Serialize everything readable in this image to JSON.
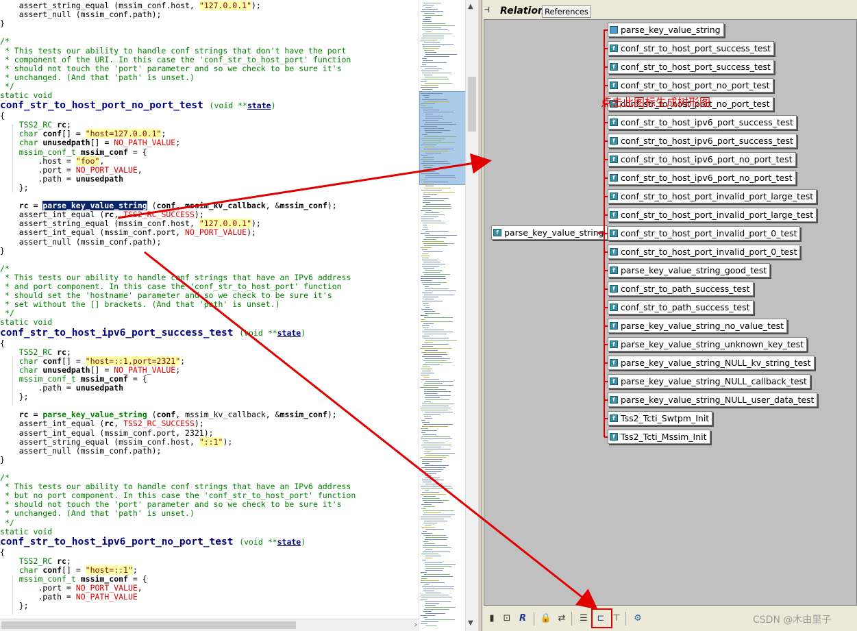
{
  "editor": {
    "lines": [
      "    assert_string_equal (mssim_conf.host, \"127.0.0.1\");",
      "    assert_null (mssim_conf.path);",
      "}",
      "",
      "/*",
      " * This tests our ability to handle conf strings that don't have the port",
      " * component of the URI. In this case the 'conf_str_to_host_port' function",
      " * should not touch the 'port' parameter and so we check to be sure it's",
      " * unchanged. (And that 'path' is unset.)",
      " */",
      "static void",
      "conf_str_to_host_port_no_port_test (void **state)",
      "{",
      "    TSS2_RC rc;",
      "    char conf[] = \"host=127.0.0.1\";",
      "    char unusedpath[] = NO_PATH_VALUE;",
      "    mssim_conf_t mssim_conf = {",
      "        .host = \"foo\",",
      "        .port = NO_PORT_VALUE,",
      "        .path = unusedpath",
      "    };",
      "",
      "    rc = parse_key_value_string (conf, mssim_kv_callback, &mssim_conf);",
      "    assert_int_equal (rc, TSS2_RC_SUCCESS);",
      "    assert_string_equal (mssim_conf.host, \"127.0.0.1\");",
      "    assert_int_equal (mssim_conf.port, NO_PORT_VALUE);",
      "    assert_null (mssim_conf.path);",
      "}",
      "",
      "/*",
      " * This tests our ability to handle conf strings that have an IPv6 address",
      " * and port component. In this case the 'conf_str_to_host_port' function",
      " * should set the 'hostname' parameter and so we check to be sure it's",
      " * set without the [] brackets. (And that 'path' is unset.)",
      " */",
      "static void",
      "conf_str_to_host_ipv6_port_success_test (void **state)",
      "{",
      "    TSS2_RC rc;",
      "    char conf[] = \"host=::1,port=2321\";",
      "    char unusedpath[] = NO_PATH_VALUE;",
      "    mssim_conf_t mssim_conf = {",
      "        .path = unusedpath",
      "    };",
      "",
      "    rc = parse_key_value_string (conf, mssim_kv_callback, &mssim_conf);",
      "    assert_int_equal (rc, TSS2_RC_SUCCESS);",
      "    assert_int_equal (mssim_conf.port, 2321);",
      "    assert_string_equal (mssim_conf.host, \"::1\");",
      "    assert_null (mssim_conf.path);",
      "}",
      "",
      "/*",
      " * This tests our ability to handle conf strings that have an IPv6 address",
      " * but no port component. In this case the 'conf_str_to_host_port' function",
      " * should not touch the 'port' parameter and so we check to be sure it's",
      " * unchanged. (And that 'path' is unset.)",
      " */",
      "static void",
      "conf_str_to_host_ipv6_port_no_port_test (void **state)",
      "{",
      "    TSS2_RC rc;",
      "    char conf[] = \"host=::1\";",
      "    mssim_conf_t mssim_conf = {",
      "        .port = NO_PORT_VALUE,",
      "        .path = NO_PATH_VALUE",
      "    };"
    ]
  },
  "relation": {
    "title": "Relation",
    "tab_label": "References",
    "root": "parse_key_value_string",
    "children": [
      {
        "label": "parse_key_value_string",
        "icon": "file"
      },
      {
        "label": "conf_str_to_host_port_success_test",
        "icon": "func"
      },
      {
        "label": "conf_str_to_host_port_success_test",
        "icon": "func"
      },
      {
        "label": "conf_str_to_host_port_no_port_test",
        "icon": "func"
      },
      {
        "label": "conf_str_to_host_port_no_port_test",
        "icon": "func"
      },
      {
        "label": "conf_str_to_host_ipv6_port_success_test",
        "icon": "func"
      },
      {
        "label": "conf_str_to_host_ipv6_port_success_test",
        "icon": "func"
      },
      {
        "label": "conf_str_to_host_ipv6_port_no_port_test",
        "icon": "func"
      },
      {
        "label": "conf_str_to_host_ipv6_port_no_port_test",
        "icon": "func"
      },
      {
        "label": "conf_str_to_host_port_invalid_port_large_test",
        "icon": "func"
      },
      {
        "label": "conf_str_to_host_port_invalid_port_large_test",
        "icon": "func"
      },
      {
        "label": "conf_str_to_host_port_invalid_port_0_test",
        "icon": "func"
      },
      {
        "label": "conf_str_to_host_port_invalid_port_0_test",
        "icon": "func"
      },
      {
        "label": "parse_key_value_string_good_test",
        "icon": "func"
      },
      {
        "label": "conf_str_to_path_success_test",
        "icon": "func"
      },
      {
        "label": "conf_str_to_path_success_test",
        "icon": "func"
      },
      {
        "label": "parse_key_value_string_no_value_test",
        "icon": "func"
      },
      {
        "label": "parse_key_value_string_unknown_key_test",
        "icon": "func"
      },
      {
        "label": "parse_key_value_string_NULL_kv_string_test",
        "icon": "func"
      },
      {
        "label": "parse_key_value_string_NULL_callback_test",
        "icon": "func"
      },
      {
        "label": "parse_key_value_string_NULL_user_data_test",
        "icon": "func"
      },
      {
        "label": "Tss2_Tcti_Swtpm_Init",
        "icon": "func"
      },
      {
        "label": "Tss2_Tcti_Mssim_Init",
        "icon": "func"
      }
    ],
    "annotation": "点击此图标生成树形图",
    "watermark": "CSDN @木由里子"
  },
  "toolbar": {
    "buttons": [
      "bookmark-icon",
      "new-tab-icon",
      "r-icon",
      "lock-icon",
      "sync-icon",
      "list-icon",
      "tree-icon",
      "hierarchy-icon",
      "gear-icon"
    ]
  },
  "colors": {
    "annotation": "#e00000",
    "selection": "#0a246a",
    "minimap_view": "#a9cbe8"
  }
}
